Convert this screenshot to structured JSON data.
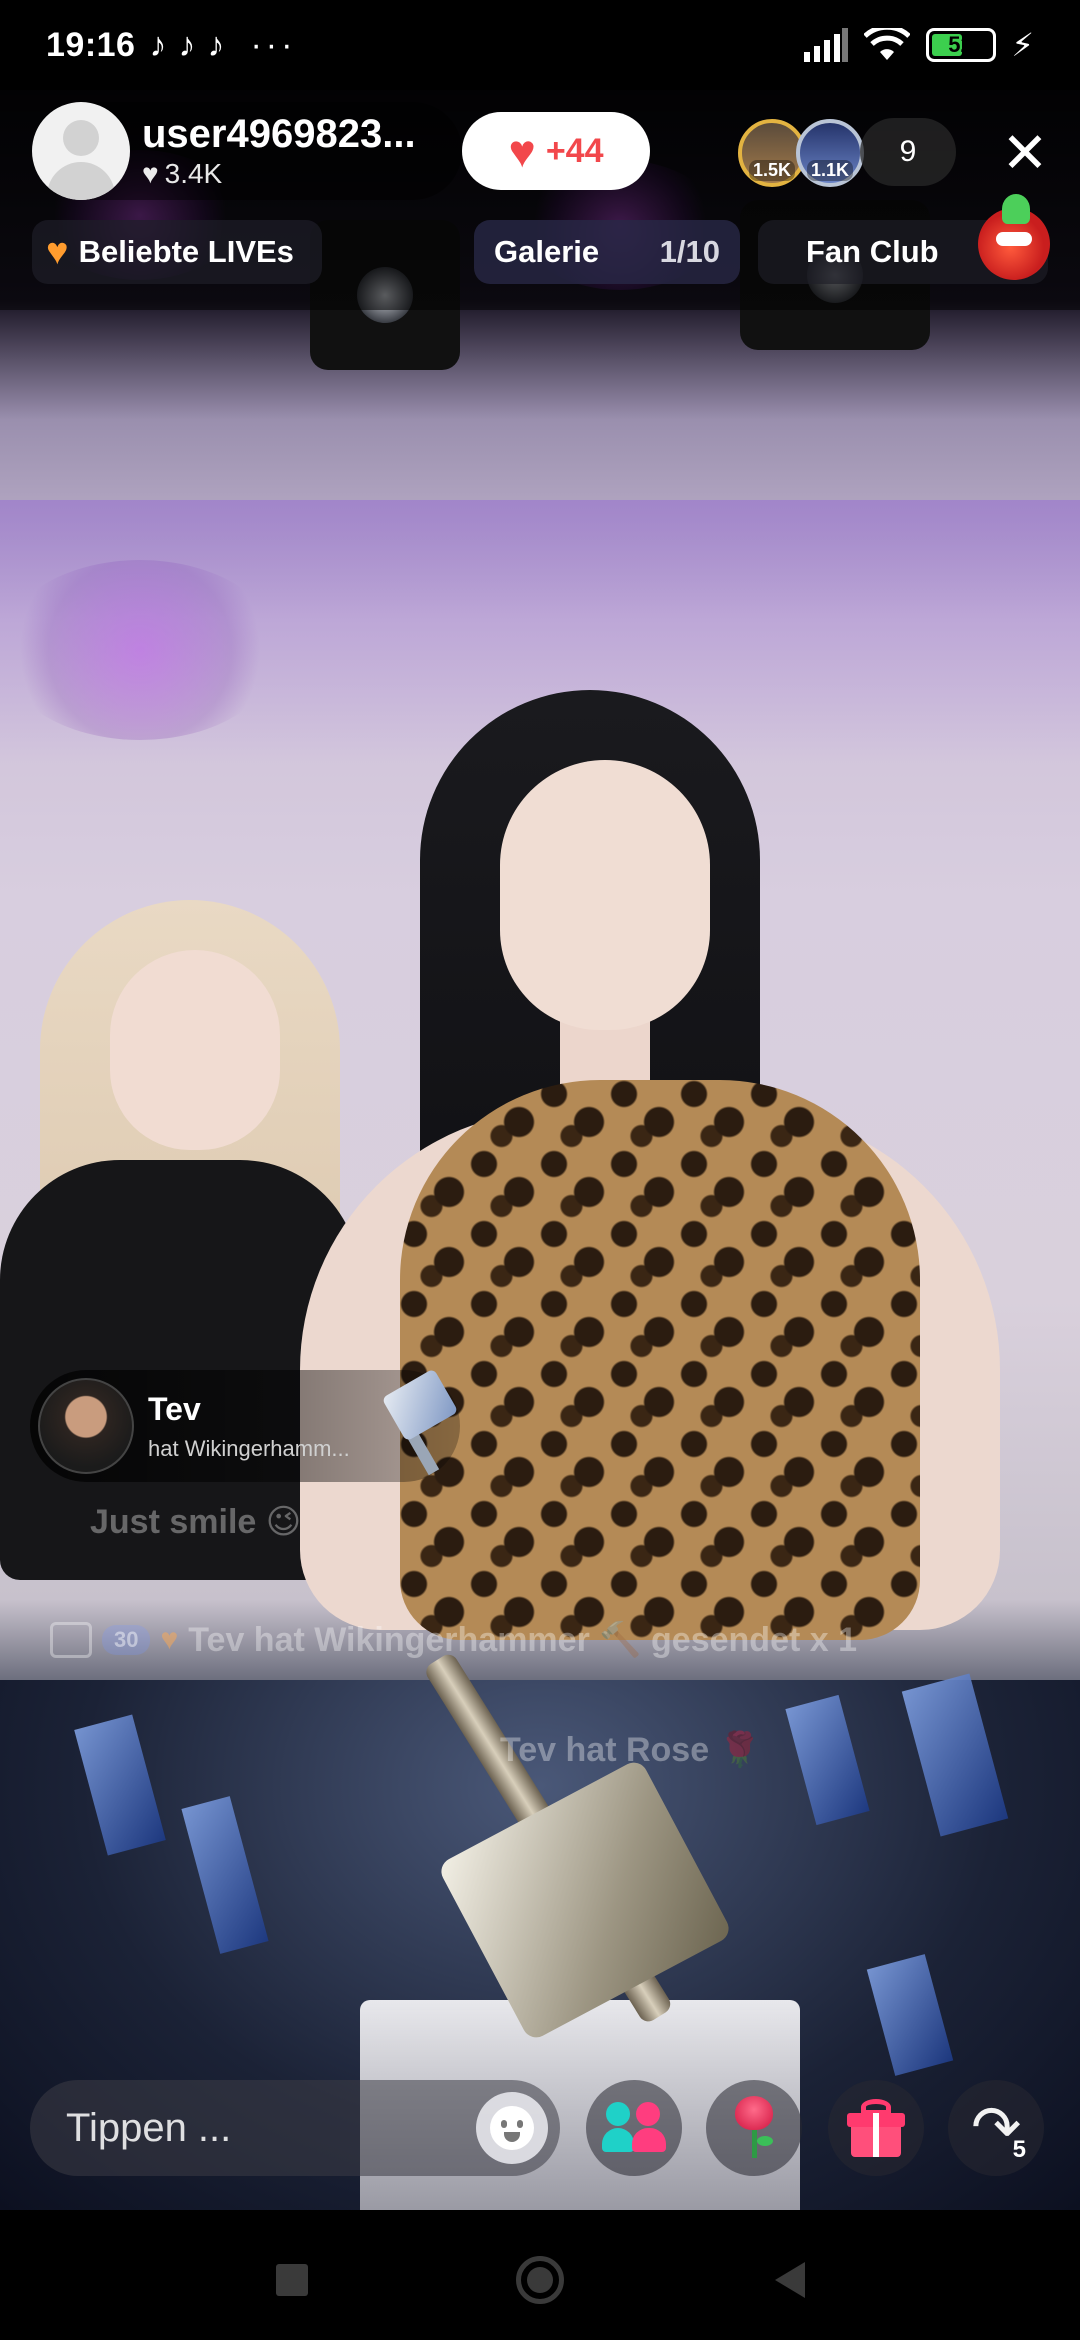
{
  "status_bar": {
    "time": "19:16",
    "app_icons": [
      "tiktok-icon",
      "tiktok-icon",
      "tiktok-icon"
    ],
    "more": "···",
    "battery_level": "52",
    "battery_percent": 0.52,
    "battery_color": "#3ccf4e"
  },
  "host": {
    "name": "user4969823...",
    "likes": "3.4K"
  },
  "like_button": {
    "count": "+44",
    "color": "#f2474b"
  },
  "top_viewers": [
    {
      "badge": "1.5K"
    },
    {
      "badge": "1.1K"
    }
  ],
  "viewer_count": "9",
  "close_label": "✕",
  "tabs": {
    "popular_lives": "Beliebte LIVEs",
    "gallery": "Galerie",
    "gallery_page": "1/10",
    "fan_club": "Fan Club"
  },
  "gift_notification": {
    "user": "Tev",
    "message": "hat Wikingerhamm..."
  },
  "chat": {
    "line1": "Just smile 😉",
    "line2_badge": "30",
    "line2": "Tev hat Wikingerhammer 🔨 gesendet x 1",
    "line3": "Tev hat Rose 🌹"
  },
  "bottom_bar": {
    "comment_placeholder": "Tippen ...",
    "share_count": "5"
  },
  "colors": {
    "accent_red": "#f2474b",
    "popular_heart": "#ff9c2e",
    "multi_guest_teal": "#1fd1c8",
    "multi_guest_pink": "#ff3d7f",
    "gift_pink": "#ff3a6e"
  }
}
